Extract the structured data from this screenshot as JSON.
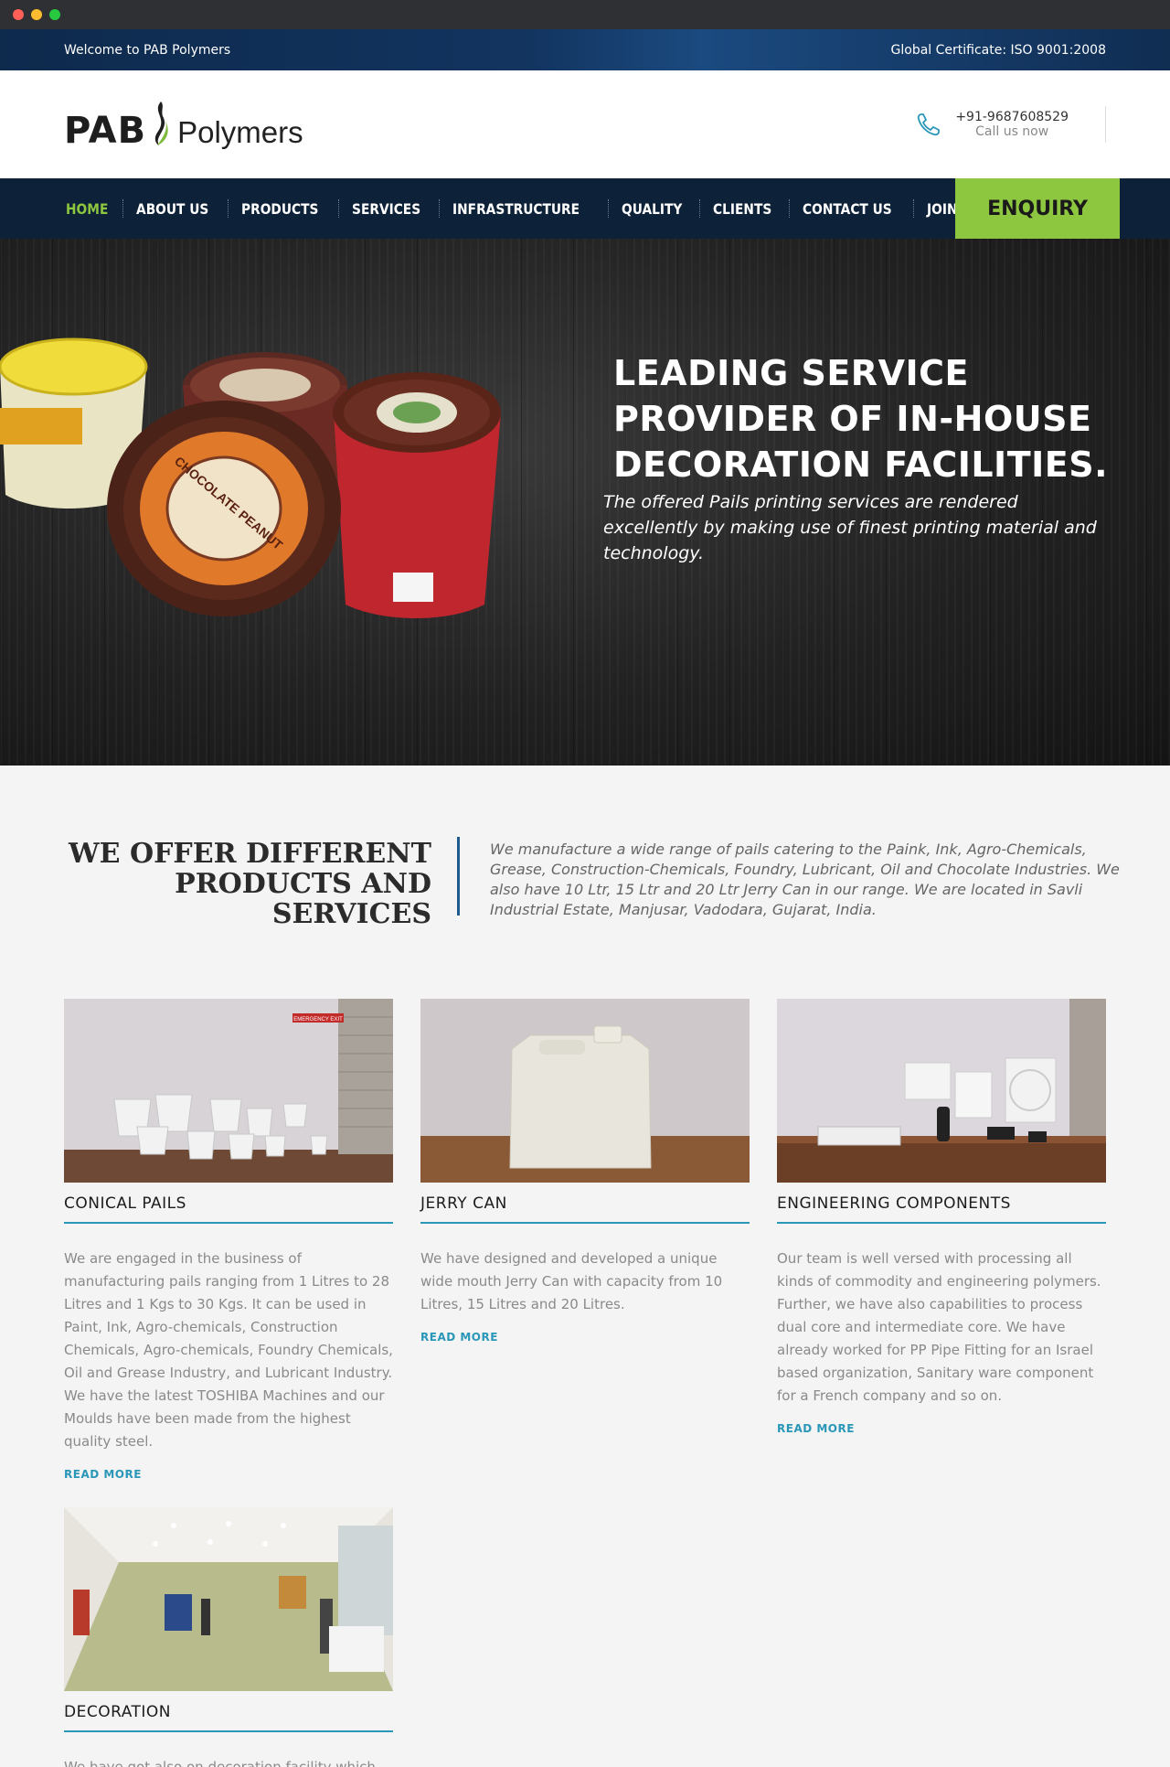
{
  "topbar": {
    "welcome": "Welcome to PAB Polymers",
    "certificate": "Global Certificate: ISO 9001:2008"
  },
  "header": {
    "logo_pab": "PAB",
    "logo_polymers": "Polymers",
    "phone": "+91-9687608529",
    "call_label": "Call us now"
  },
  "nav": {
    "items": [
      "HOME",
      "ABOUT US",
      "PRODUCTS",
      "SERVICES",
      "INFRASTRUCTURE",
      "QUALITY",
      "CLIENTS",
      "CONTACT US",
      "JOIN US"
    ],
    "enquiry": "ENQUIRY"
  },
  "hero": {
    "title": "LEADING SERVICE PROVIDER OF IN-HOUSE DECORATION FACILITIES.",
    "subtitle": "The offered Pails printing services are rendered excellently by making use of finest printing material and technology."
  },
  "intro": {
    "title": "WE OFFER DIFFERENT PRODUCTS AND SERVICES",
    "text": "We manufacture a wide range of pails catering to the Paink, Ink, Agro-Chemicals, Grease, Construction-Chemicals, Foundry, Lubricant, Oil and Chocolate Industries. We also have 10 Ltr, 15 Ltr and 20 Ltr Jerry Can in our range. We are located in Savli Industrial Estate, Manjusar, Vadodara, Gujarat, India."
  },
  "products": [
    {
      "title": "CONICAL PAILS",
      "text": "We are engaged in the business of manufacturing pails ranging from 1 Litres to 28 Litres and 1 Kgs to 30 Kgs. It can be used in Paint, Ink, Agro-chemicals, Construction Chemicals, Agro-chemicals, Foundry Chemicals, Oil and Grease Industry, and Lubricant Industry. We have the latest TOSHIBA Machines and our Moulds have been made from the highest quality steel.",
      "link": "READ MORE"
    },
    {
      "title": "JERRY CAN",
      "text": "We have designed and developed a unique wide mouth Jerry Can with capacity from 10 Litres, 15 Litres and 20 Litres.",
      "link": "READ MORE"
    },
    {
      "title": "ENGINEERING COMPONENTS",
      "text": "Our team is well versed with processing all kinds of commodity and engineering polymers. Further, we have also capabilities to process dual core and intermediate core. We have already worked for PP Pipe Fitting for an Israel based organization, Sanitary ware component for a French company and so on.",
      "link": "READ MORE"
    },
    {
      "title": "DECORATION",
      "text": "We have got also on decoration facility which",
      "link": ""
    }
  ],
  "image_text": {
    "emergency_exit": "EMERGENCY EXIT",
    "tub_label": "CHOCOLATE PEANUT"
  },
  "colors": {
    "accent_green": "#8dc63f",
    "accent_blue": "#2a97b8",
    "nav_bg": "#0d2238"
  }
}
